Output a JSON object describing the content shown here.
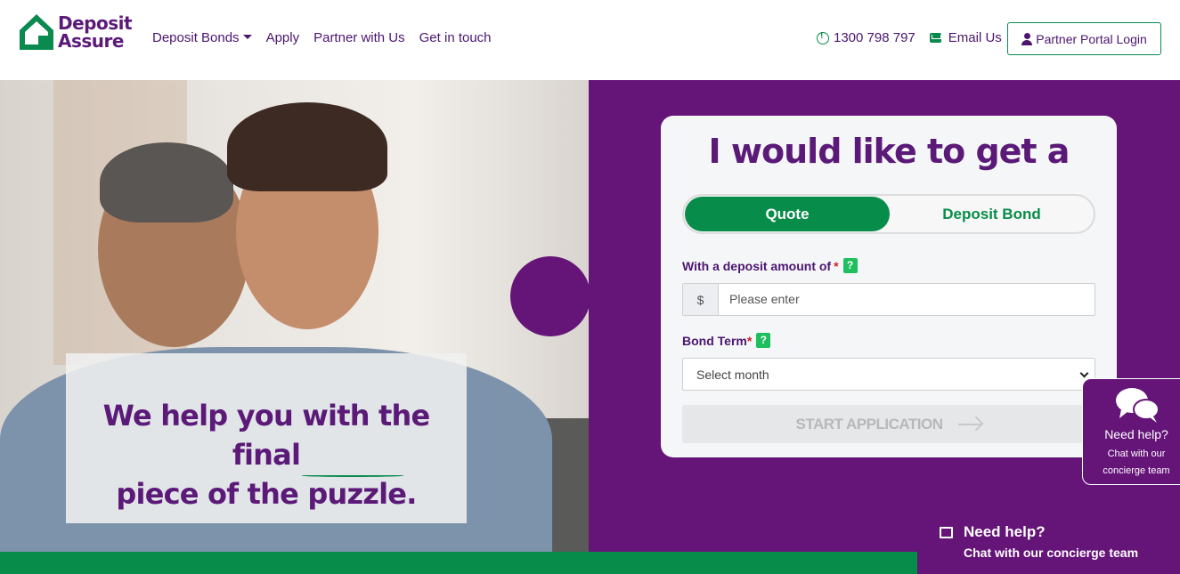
{
  "header": {
    "logo_line1": "Deposit",
    "logo_line2": "Assure",
    "nav": [
      "Deposit Bonds",
      "Apply",
      "Partner with Us",
      "Get in touch"
    ],
    "phone": "1300 798 797",
    "email": "Email Us",
    "portal_login": "Partner Portal Login"
  },
  "hero": {
    "line1": "We help you with the final",
    "line2": "piece of the puzzle."
  },
  "form": {
    "title": "I would like to get a",
    "toggle_options": [
      "Quote",
      "Deposit Bond"
    ],
    "active_toggle": "Quote",
    "deposit_label": "With a deposit amount of",
    "required_mark": "*",
    "help_mark": "?",
    "currency_prefix": "$",
    "amount_placeholder": "Please enter",
    "bond_term_label": "Bond Term",
    "bond_term_value": "Select month",
    "start_button": "START APPLICATION"
  },
  "chat_widget": {
    "title": "Need help?",
    "subtitle_line1": "Chat with our",
    "subtitle_line2": "concierge team"
  },
  "bottom_help": {
    "title": "Need help?",
    "subtitle": "Chat with our concierge team"
  },
  "colors": {
    "brand_purple": "#651478",
    "brand_green": "#078c4a",
    "text_purple": "#5b1a78"
  }
}
